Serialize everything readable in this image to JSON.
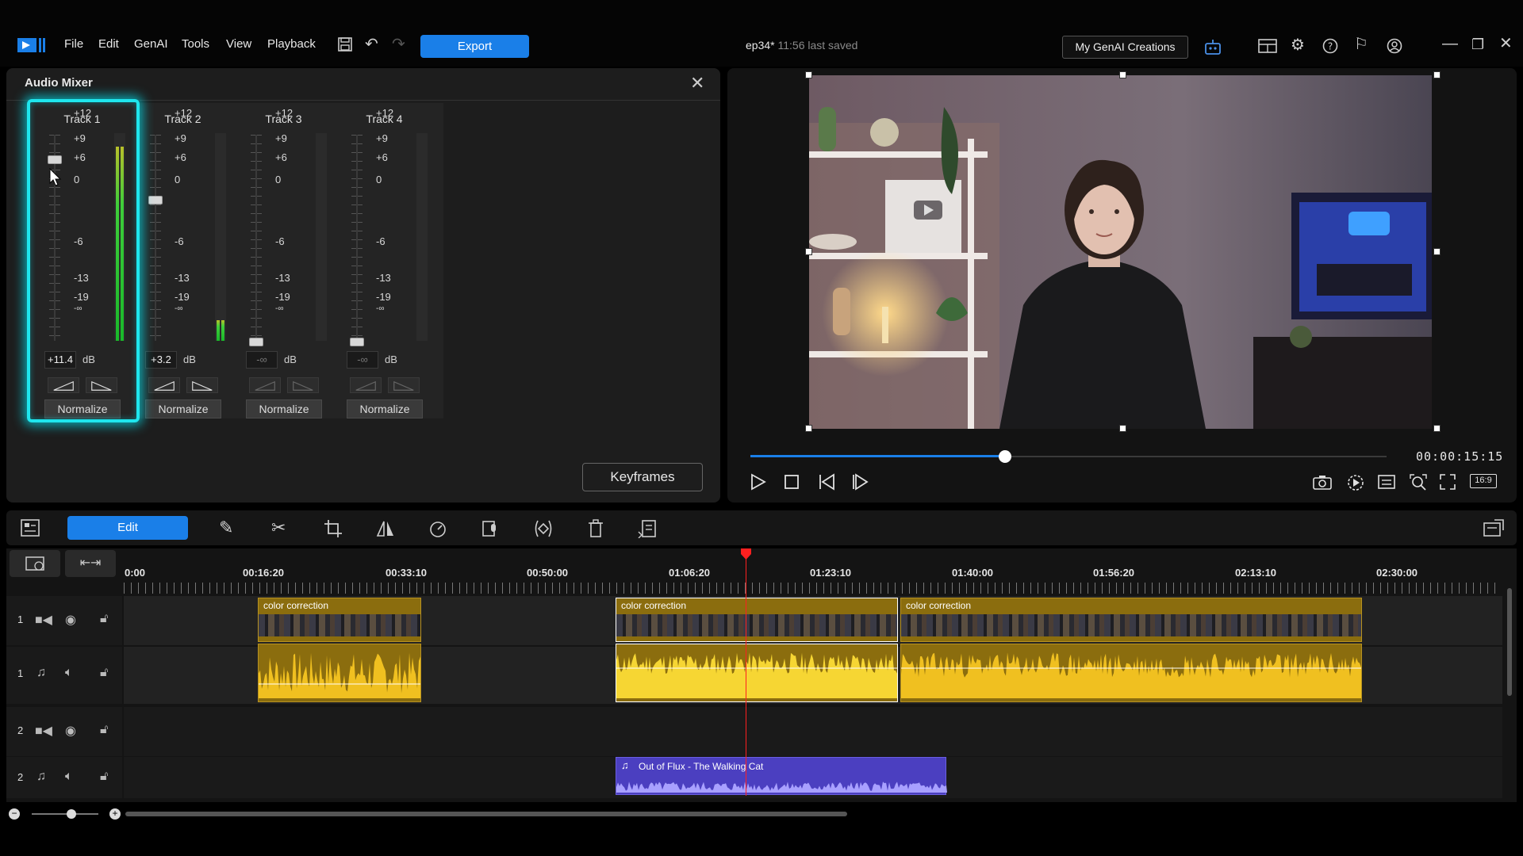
{
  "app": {
    "menu": [
      "File",
      "Edit",
      "GenAI",
      "Tools",
      "View",
      "Playback"
    ],
    "export_label": "Export",
    "project_name": "ep34*",
    "save_status": "11:56 last saved",
    "genai_button": "My GenAI Creations"
  },
  "mixer": {
    "title": "Audio Mixer",
    "scale": [
      "+12",
      "+9",
      "+6",
      "0",
      "-6",
      "-13",
      "-19",
      "-∞"
    ],
    "db_unit": "dB",
    "normalize_label": "Normalize",
    "keyframes_label": "Keyframes",
    "tracks": [
      {
        "name": "Track 1",
        "value": "+11.4",
        "level": 0.9,
        "meter": 0.95
      },
      {
        "name": "Track 2",
        "value": "+3.2",
        "level": 0.7,
        "meter": 0.1
      },
      {
        "name": "Track 3",
        "value": "-∞",
        "level": 0.0,
        "meter": 0.0
      },
      {
        "name": "Track 4",
        "value": "-∞",
        "level": 0.0,
        "meter": 0.0
      }
    ]
  },
  "preview": {
    "timecode": "00:00:15:15",
    "progress": 0.4,
    "aspect": "16:9"
  },
  "toolbar": {
    "edit_tab": "Edit"
  },
  "timeline": {
    "ruler": [
      "0:00",
      "00:16:20",
      "00:33:10",
      "00:50:00",
      "01:06:20",
      "01:23:10",
      "01:40:00",
      "01:56:20",
      "02:13:10",
      "02:30:00"
    ],
    "tracks": [
      {
        "num": "1",
        "kind": "video"
      },
      {
        "num": "1",
        "kind": "audio"
      },
      {
        "num": "2",
        "kind": "video"
      },
      {
        "num": "2",
        "kind": "audio"
      }
    ],
    "clip_label": "color correction",
    "music_clip": "Out of Flux - The Walking Cat"
  },
  "colors": {
    "accent": "#1a7fe8",
    "highlight": "#1fe6ee",
    "clip": "#8b6d0e",
    "music": "#4b3fc0",
    "playhead": "#ff2020"
  }
}
